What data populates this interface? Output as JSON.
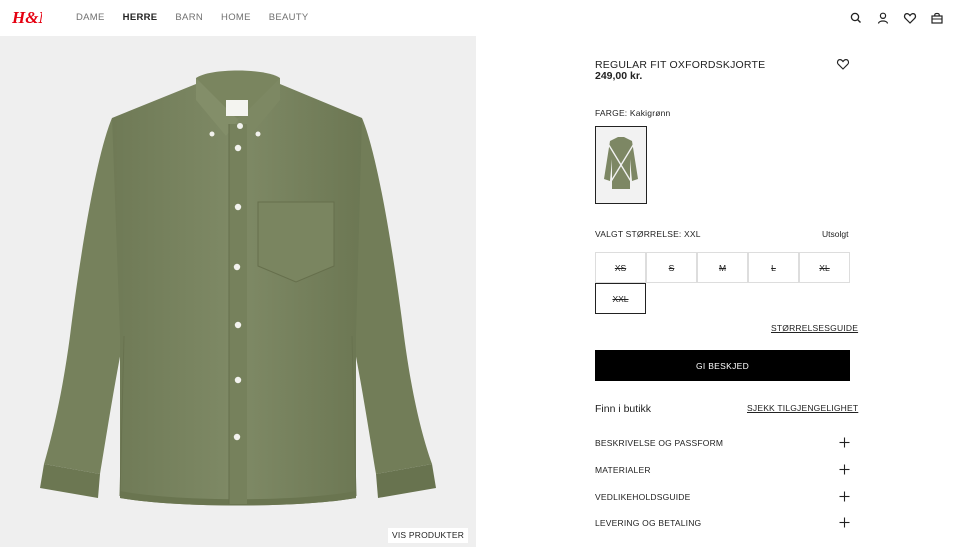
{
  "header": {
    "logo_text": "H&M",
    "nav": [
      {
        "label": "DAME",
        "active": false
      },
      {
        "label": "HERRE",
        "active": true
      },
      {
        "label": "BARN",
        "active": false
      },
      {
        "label": "HOME",
        "active": false
      },
      {
        "label": "BEAUTY",
        "active": false
      }
    ],
    "icons": [
      "search-icon",
      "account-icon",
      "favorites-icon",
      "cart-icon"
    ]
  },
  "gallery": {
    "vis_produkter_label": "VIS PRODUKTER"
  },
  "product": {
    "title": "REGULAR FIT OXFORDSKJORTE",
    "price": "249,00 kr.",
    "color_label": "FARGE: Kakigrønn",
    "size_label": "VALGT STØRRELSE: XXL",
    "sold_out": "Utsolgt",
    "sizes": [
      "XS",
      "S",
      "M",
      "L",
      "XL",
      "XXL"
    ],
    "selected_size": "XXL",
    "size_guide_label": "STØRRELSESGUIDE",
    "notify_label": "GI BESKJED",
    "find_store_label": "Finn i butikk",
    "check_availability_label": "SJEKK TILGJENGELIGHET",
    "accordion": [
      "BESKRIVELSE OG PASSFORM",
      "MATERIALER",
      "VEDLIKEHOLDSGUIDE",
      "LEVERING OG BETALING"
    ]
  },
  "colors": {
    "brand_red": "#e50010",
    "shirt_green": "#7d8764",
    "button_black": "#000000",
    "image_bg": "#efefef"
  }
}
